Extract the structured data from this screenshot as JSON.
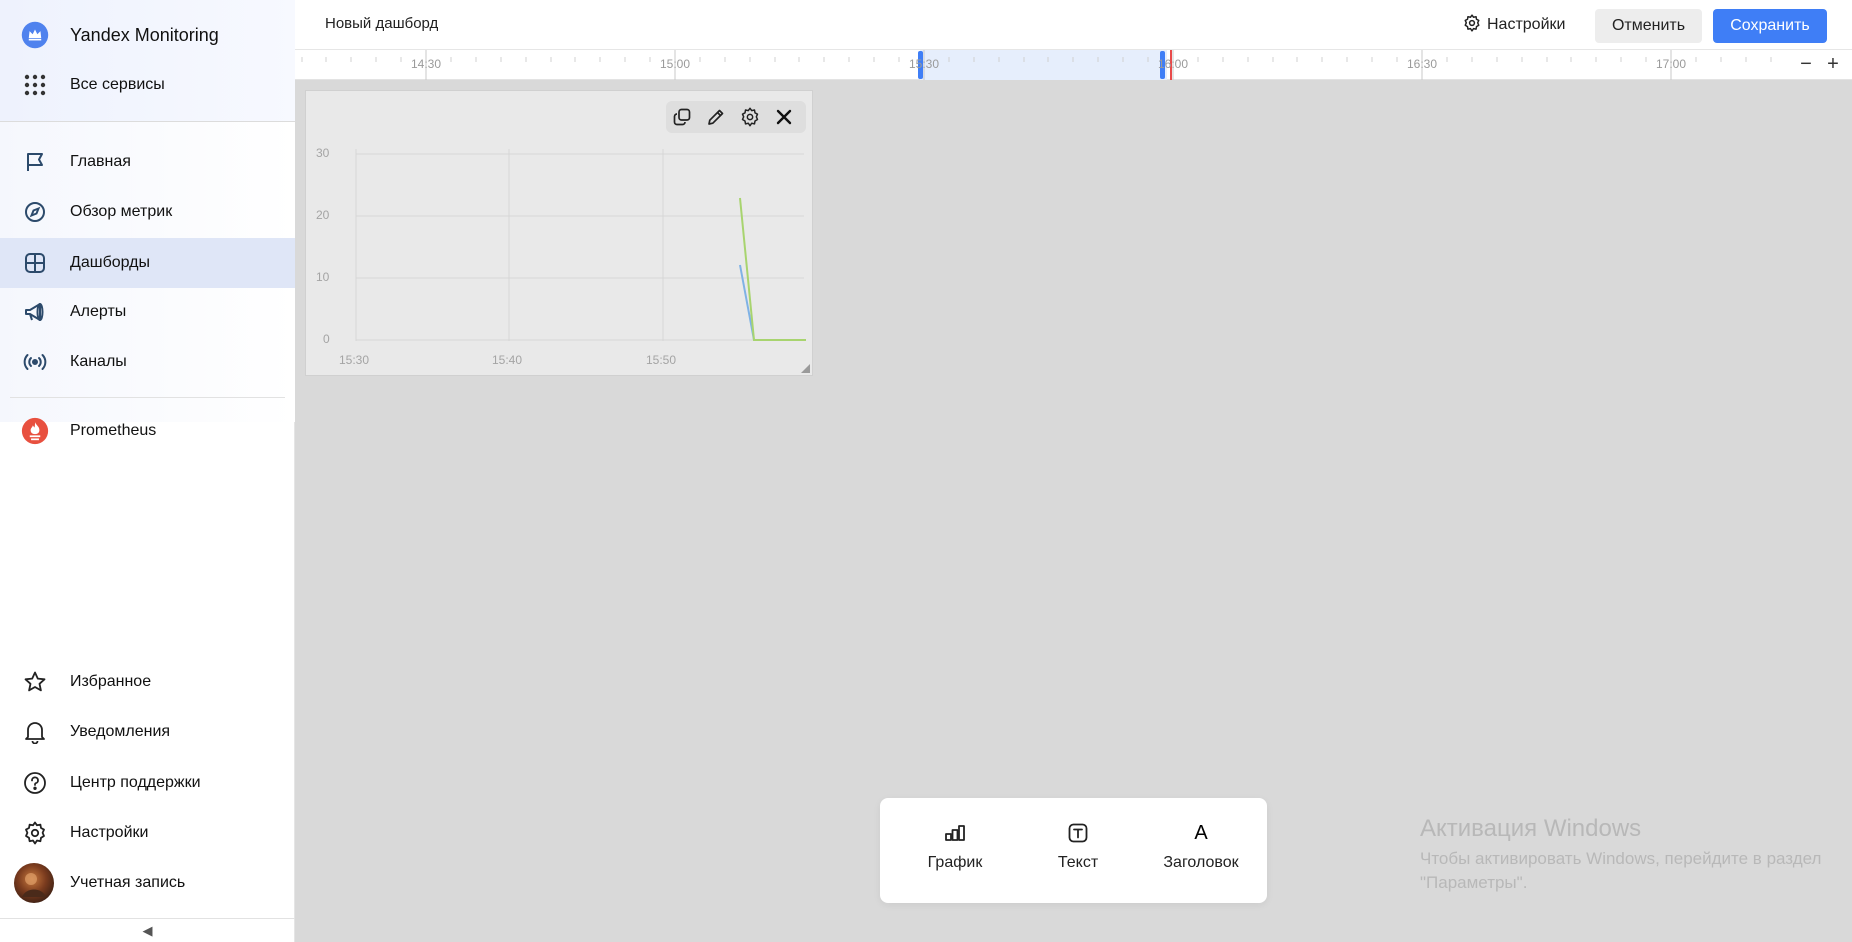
{
  "sidebar": {
    "brand": "Yandex Monitoring",
    "all_services": "Все сервисы",
    "nav": [
      {
        "label": "Главная",
        "icon": "flag-icon"
      },
      {
        "label": "Обзор метрик",
        "icon": "compass-icon"
      },
      {
        "label": "Дашборды",
        "icon": "dashboard-icon",
        "active": true
      },
      {
        "label": "Алерты",
        "icon": "megaphone-icon"
      },
      {
        "label": "Каналы",
        "icon": "broadcast-icon"
      }
    ],
    "prometheus": "Prometheus",
    "bottom": [
      {
        "label": "Избранное",
        "icon": "star-icon"
      },
      {
        "label": "Уведомления",
        "icon": "bell-icon"
      },
      {
        "label": "Центр поддержки",
        "icon": "help-icon"
      },
      {
        "label": "Настройки",
        "icon": "gear-icon"
      },
      {
        "label": "Учетная запись",
        "icon": "avatar"
      }
    ],
    "collapse_glyph": "◀"
  },
  "header": {
    "title": "Новый дашборд",
    "settings_label": "Настройки",
    "cancel_label": "Отменить",
    "save_label": "Сохранить"
  },
  "timeline": {
    "labels": [
      "14:30",
      "15:00",
      "15:30",
      "16:00",
      "16:30",
      "17:00"
    ],
    "zoom_out": "−",
    "zoom_in": "+"
  },
  "widget": {
    "y_ticks": [
      "30",
      "20",
      "10",
      "0"
    ],
    "x_ticks": [
      "15:30",
      "15:40",
      "15:50"
    ]
  },
  "add_panel": {
    "graph_label": "График",
    "text_label": "Текст",
    "heading_label": "Заголовок",
    "heading_glyph": "A"
  },
  "watermark": {
    "title": "Активация Windows",
    "text": "Чтобы активировать Windows, перейдите в раздел \"Параметры\"."
  },
  "colors": {
    "accent": "#3f7ef6",
    "active_nav": "#dfe6f7",
    "series_green": "#a8d46f",
    "series_blue": "#7fb2e5",
    "prometheus": "#e8503f"
  }
}
